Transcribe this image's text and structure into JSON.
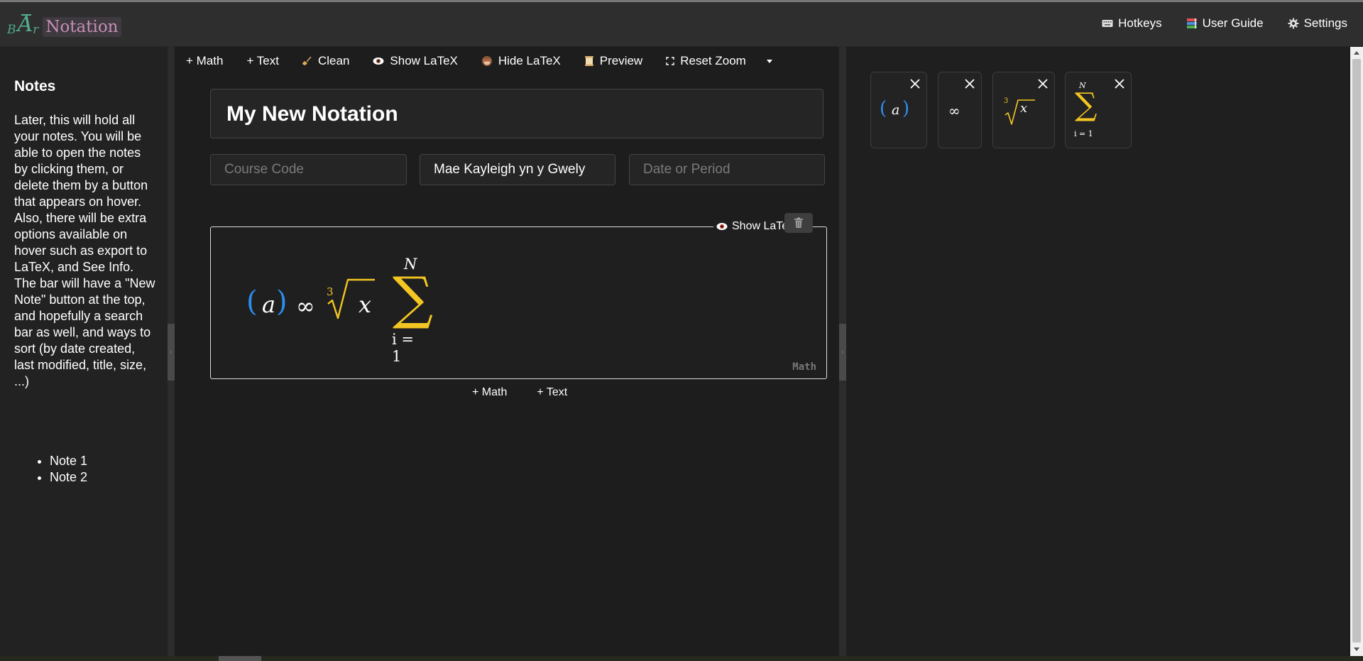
{
  "app": {
    "logo_text": "Notation"
  },
  "header_nav": [
    {
      "label": "Hotkeys",
      "icon": "keyboard-icon"
    },
    {
      "label": "User Guide",
      "icon": "books-icon"
    },
    {
      "label": "Settings",
      "icon": "gear-icon"
    }
  ],
  "sidebar": {
    "heading": "Notes",
    "description": "Later, this will hold all your notes. You will be able to open the notes by clicking them, or delete them by a button that appears on hover. Also, there will be extra options available on hover such as export to LaTeX, and See Info. The bar will have a \"New Note\" button at the top, and hopefully a search bar as well, and ways to sort (by date created, last modified, title, size, ...)",
    "notes": [
      "Note 1",
      "Note 2"
    ]
  },
  "toolbar": {
    "add_math": "+ Math",
    "add_text": "+ Text",
    "clean": "Clean",
    "show_latex": "Show LaTeX",
    "hide_latex": "Hide LaTeX",
    "preview": "Preview",
    "reset_zoom": "Reset Zoom"
  },
  "document": {
    "title": "My New Notation",
    "course_code": {
      "value": "",
      "placeholder": "Course Code"
    },
    "author": {
      "value": "Mae Kayleigh yn y Gwely",
      "placeholder": ""
    },
    "date": {
      "value": "",
      "placeholder": "Date or Period"
    }
  },
  "math_block": {
    "show_latex_label": "Show LaTeX",
    "kind_label": "Math",
    "formula": {
      "paren_left": "(",
      "var_a": "a",
      "paren_right": ")",
      "infinity": "∞",
      "root_index": "3",
      "radicand": "x",
      "sum_upper": "N",
      "sum_symbol": "∑",
      "sum_lower": "i = 1"
    }
  },
  "add_row": {
    "math": "+ Math",
    "text": "+ Text"
  },
  "palette": [
    {
      "id": "paren-a"
    },
    {
      "id": "infinity",
      "symbol": "∞"
    },
    {
      "id": "cube-root",
      "index": "3",
      "radicand": "x"
    },
    {
      "id": "summation",
      "upper": "N",
      "symbol": "∑",
      "lower": "i = 1"
    }
  ],
  "colors": {
    "accent_blue": "#2d8cf0",
    "accent_yellow": "#f3c623",
    "accent_teal": "#2bc1a6",
    "logo_pink": "#c78fb8"
  }
}
